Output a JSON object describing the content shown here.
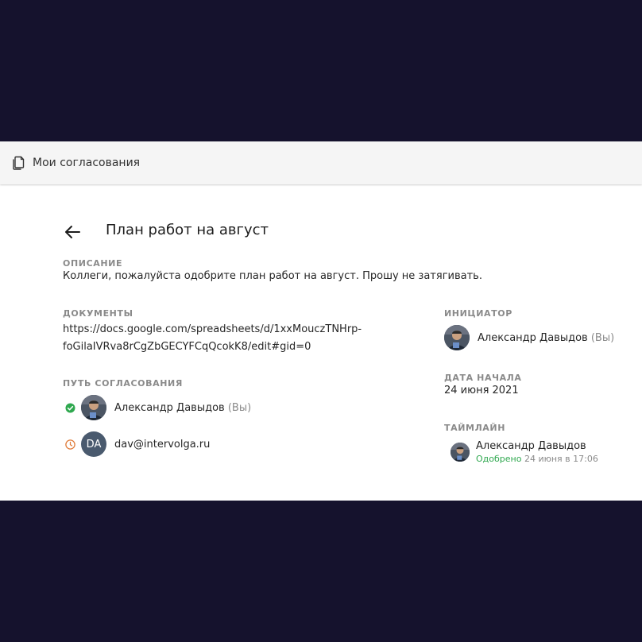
{
  "topbar": {
    "title": "Мои согласования",
    "icon": "document-icon"
  },
  "page": {
    "title": "План работ на август"
  },
  "description": {
    "label": "ОПИСАНИЕ",
    "text": "Коллеги, пожалуйста одобрите план работ на август. Прошу не затягивать."
  },
  "documents": {
    "label": "ДОКУМЕНТЫ",
    "link_line1": "https://docs.google.com/spreadsheets/d/1xxMouczTNHrp-",
    "link_line2": "foGilaIVRva8rCgZbGECYFCqQcokK8/edit#gid=0"
  },
  "route": {
    "label": "ПУТЬ СОГЛАСОВАНИЯ",
    "steps": [
      {
        "name": "Александр Давыдов",
        "suffix": "(Вы)",
        "status": "approved",
        "status_color": "#2fa84f",
        "avatar": "photo"
      },
      {
        "name": "dav@intervolga.ru",
        "suffix": "",
        "status": "pending",
        "status_color": "#e07b39",
        "avatar_initials": "DA"
      }
    ]
  },
  "initiator": {
    "label": "ИНИЦИАТОР",
    "name": "Александр Давыдов",
    "suffix": "(Вы)"
  },
  "start_date": {
    "label": "ДАТА НАЧАЛА",
    "value": "24 июня 2021"
  },
  "timeline": {
    "label": "ТАЙМЛАЙН",
    "entries": [
      {
        "name": "Александр Давыдов",
        "status": "Одобрено",
        "time": "24 июня в 17:06"
      }
    ]
  },
  "colors": {
    "background": "#15122d",
    "approved": "#2fa84f",
    "pending": "#e07b39"
  }
}
